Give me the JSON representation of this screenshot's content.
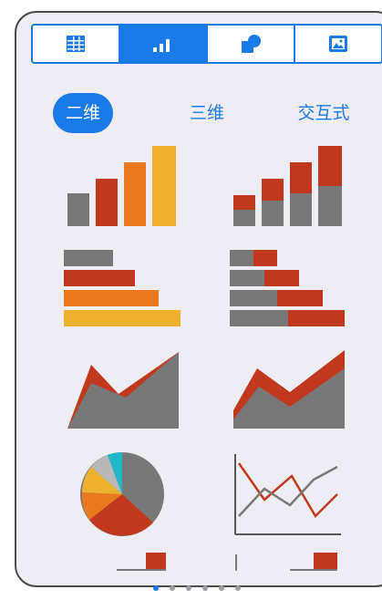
{
  "toolbar": {
    "items": [
      {
        "icon": "table-icon",
        "active": false
      },
      {
        "icon": "chart-icon",
        "active": true
      },
      {
        "icon": "shapes-icon",
        "active": false
      },
      {
        "icon": "image-icon",
        "active": false
      }
    ],
    "accent": "#1a7ae8"
  },
  "tabs": [
    {
      "label": "二维",
      "active": true
    },
    {
      "label": "三维",
      "active": false
    },
    {
      "label": "交互式",
      "active": false
    }
  ],
  "colors": {
    "gray": "#777777",
    "red": "#c0391f",
    "orange": "#e8791c",
    "yellow": "#eeb12e",
    "teal": "#1fb8c4",
    "lightgray": "#b8b8b8"
  },
  "chart_gallery": [
    {
      "name": "column-chart-option"
    },
    {
      "name": "stacked-column-chart-option"
    },
    {
      "name": "bar-chart-option"
    },
    {
      "name": "stacked-bar-chart-option"
    },
    {
      "name": "area-chart-option"
    },
    {
      "name": "stacked-area-chart-option"
    },
    {
      "name": "pie-chart-option"
    },
    {
      "name": "line-chart-option"
    }
  ],
  "pager": {
    "count": 6,
    "active": 0
  }
}
